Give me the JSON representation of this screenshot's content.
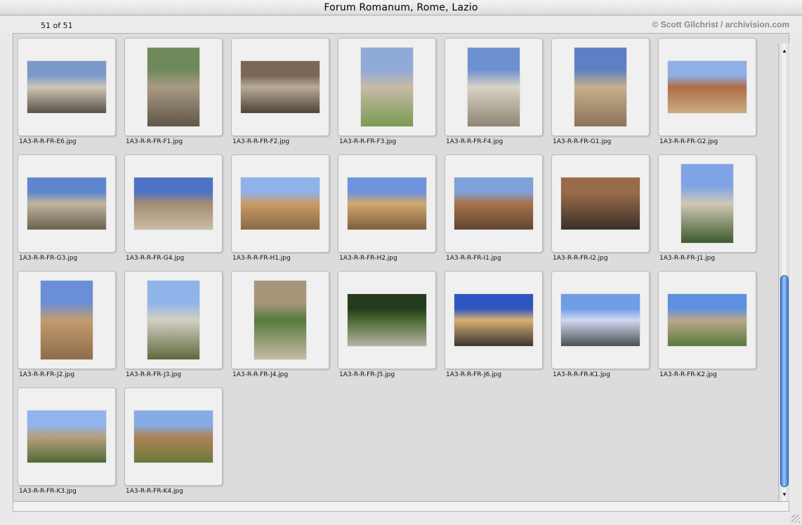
{
  "window": {
    "title": "Forum Romanum, Rome, Lazio"
  },
  "info": {
    "count": "51 of 51",
    "credit": "© Scott Gilchrist / archivision.com"
  },
  "items": [
    {
      "name": "1A3-R-R-FR-E6.jpg",
      "orientation": "land",
      "colors": [
        "#7c99c9",
        "#cfc6b6",
        "#5a5248"
      ]
    },
    {
      "name": "1A3-R-R-FR-F1.jpg",
      "orientation": "port",
      "colors": [
        "#6f8a5a",
        "#a99a84",
        "#5f5649"
      ]
    },
    {
      "name": "1A3-R-R-FR-F2.jpg",
      "orientation": "land",
      "colors": [
        "#7a6757",
        "#b8ab97",
        "#4f4238"
      ]
    },
    {
      "name": "1A3-R-R-FR-F3.jpg",
      "orientation": "port",
      "colors": [
        "#8fa9d8",
        "#c7bba6",
        "#7a9a52"
      ]
    },
    {
      "name": "1A3-R-R-FR-F4.jpg",
      "orientation": "port",
      "colors": [
        "#6e90d0",
        "#d9d3c6",
        "#8f8573"
      ]
    },
    {
      "name": "1A3-R-R-FR-G1.jpg",
      "orientation": "port",
      "colors": [
        "#5f7fc4",
        "#c7b08b",
        "#8a7357"
      ]
    },
    {
      "name": "1A3-R-R-FR-G2.jpg",
      "orientation": "land",
      "colors": [
        "#8fb0e6",
        "#b06c45",
        "#c9ad84"
      ]
    },
    {
      "name": "1A3-R-R-FR-G3.jpg",
      "orientation": "land",
      "colors": [
        "#5e86cf",
        "#c1b49c",
        "#6c6152"
      ]
    },
    {
      "name": "1A3-R-R-FR-G4.jpg",
      "orientation": "land",
      "colors": [
        "#4d74c4",
        "#a38c72",
        "#cbbca5"
      ]
    },
    {
      "name": "1A3-R-R-FR-H1.jpg",
      "orientation": "land",
      "colors": [
        "#8fb2ea",
        "#c99b67",
        "#8b6a46"
      ]
    },
    {
      "name": "1A3-R-R-FR-H2.jpg",
      "orientation": "land",
      "colors": [
        "#6d93dc",
        "#d2a86f",
        "#7c5f3c"
      ]
    },
    {
      "name": "1A3-R-R-FR-I1.jpg",
      "orientation": "land",
      "colors": [
        "#7fa1d9",
        "#a9724a",
        "#5f4533"
      ]
    },
    {
      "name": "1A3-R-R-FR-I2.jpg",
      "orientation": "land",
      "colors": [
        "#9a6b4a",
        "#7c5a40",
        "#3a2e28"
      ]
    },
    {
      "name": "1A3-R-R-FR-J1.jpg",
      "orientation": "port",
      "colors": [
        "#7ea4e6",
        "#cfc8b6",
        "#3f5a2e"
      ]
    },
    {
      "name": "1A3-R-R-FR-J2.jpg",
      "orientation": "port",
      "colors": [
        "#6a8fd6",
        "#c49b6f",
        "#8e6d4b"
      ]
    },
    {
      "name": "1A3-R-R-FR-J3.jpg",
      "orientation": "port",
      "colors": [
        "#8fb4ea",
        "#d4cfc2",
        "#5d6a3f"
      ]
    },
    {
      "name": "1A3-R-R-FR-J4.jpg",
      "orientation": "port",
      "colors": [
        "#a8967a",
        "#567a3d",
        "#c8bca6"
      ]
    },
    {
      "name": "1A3-R-R-FR-J5.jpg",
      "orientation": "land",
      "colors": [
        "#253b1e",
        "#4b6a32",
        "#b8b2a6"
      ]
    },
    {
      "name": "1A3-R-R-FR-J6.jpg",
      "orientation": "land",
      "colors": [
        "#2f56c0",
        "#d8b071",
        "#3b3530"
      ]
    },
    {
      "name": "1A3-R-R-FR-K1.jpg",
      "orientation": "land",
      "colors": [
        "#6f9de6",
        "#cfd9f0",
        "#4c4f55"
      ]
    },
    {
      "name": "1A3-R-R-FR-K2.jpg",
      "orientation": "land",
      "colors": [
        "#5f8fe0",
        "#b9a88c",
        "#5a7a3d"
      ]
    },
    {
      "name": "1A3-R-R-FR-K3.jpg",
      "orientation": "land",
      "colors": [
        "#8fb4ee",
        "#b7a07e",
        "#4f6a36"
      ]
    },
    {
      "name": "1A3-R-R-FR-K4.jpg",
      "orientation": "land",
      "colors": [
        "#86ace6",
        "#b08257",
        "#6b7a3c"
      ]
    }
  ],
  "scrollbar": {
    "up_icon": "triangle-up",
    "down_icon": "triangle-down",
    "position": 0.82
  }
}
